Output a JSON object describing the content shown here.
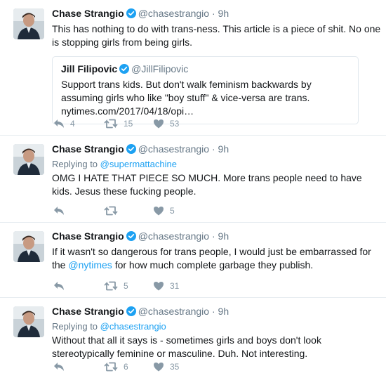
{
  "tweets": [
    {
      "name": "Chase Strangio",
      "handle": "@chasestrangio",
      "separator": "·",
      "time": "9h",
      "reply_prefix": "",
      "reply_to": "",
      "text": "This has nothing to do with trans-ness. This article is a piece of shit. No one is stopping girls from being girls.",
      "quote": {
        "name": "Jill Filipovic",
        "handle": "@JillFilipovic",
        "text": "Support trans kids. But don't walk feminism backwards by assuming girls who like \"boy stuff\" & vice-versa are trans. nytimes.com/2017/04/18/opi…"
      },
      "counts": {
        "reply": "4",
        "retweet": "15",
        "like": "53"
      }
    },
    {
      "name": "Chase Strangio",
      "handle": "@chasestrangio",
      "separator": "·",
      "time": "9h",
      "reply_prefix": "Replying to ",
      "reply_to": "@supermattachine",
      "text": "OMG I HATE THAT PIECE SO MUCH. More trans people need to have kids. Jesus these fucking people.",
      "counts": {
        "reply": "",
        "retweet": "",
        "like": "5"
      }
    },
    {
      "name": "Chase Strangio",
      "handle": "@chasestrangio",
      "separator": "·",
      "time": "9h",
      "text_before": "If it wasn't so dangerous for trans people, I would just be embarrassed for the ",
      "text_mention": "@nytimes",
      "text_after": " for how much complete garbage they publish.",
      "counts": {
        "reply": "",
        "retweet": "5",
        "like": "31"
      }
    },
    {
      "name": "Chase Strangio",
      "handle": "@chasestrangio",
      "separator": "·",
      "time": "9h",
      "reply_prefix": "Replying to ",
      "reply_to": "@chasestrangio",
      "text": "Without that all it says is - sometimes girls and boys don't look stereotypically feminine or masculine. Duh. Not interesting.",
      "counts": {
        "reply": "",
        "retweet": "6",
        "like": "35"
      }
    }
  ],
  "icons": {
    "reply": "reply-icon",
    "retweet": "retweet-icon",
    "like": "heart-icon",
    "verified": "verified-badge-icon"
  },
  "colors": {
    "link": "#1da1f2",
    "muted": "#657786",
    "action": "#8899a6",
    "divider": "#e6ecf0"
  }
}
